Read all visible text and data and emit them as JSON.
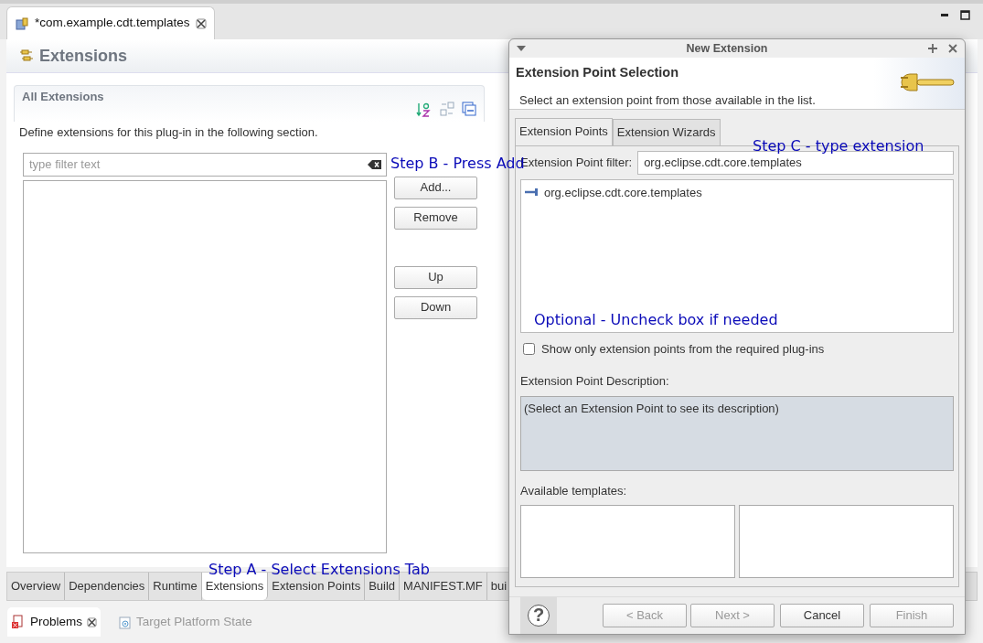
{
  "editor_tab": {
    "title": "*com.example.cdt.templates"
  },
  "page": {
    "title": "Extensions"
  },
  "section": {
    "title": "All Extensions",
    "description": "Define extensions for this plug-in in the following section.",
    "filter": {
      "placeholder": "type filter text"
    },
    "buttons": [
      {
        "label": "Add..."
      },
      {
        "label": "Remove"
      },
      {
        "label": "Up"
      },
      {
        "label": "Down"
      }
    ]
  },
  "bottom_tabs": [
    {
      "label": "Overview",
      "selected": false
    },
    {
      "label": "Dependencies",
      "selected": false
    },
    {
      "label": "Runtime",
      "selected": false
    },
    {
      "label": "Extensions",
      "selected": true
    },
    {
      "label": "Extension Points",
      "selected": false
    },
    {
      "label": "Build",
      "selected": false
    },
    {
      "label": "MANIFEST.MF",
      "selected": false
    },
    {
      "label": "bui",
      "selected": false
    }
  ],
  "views": [
    {
      "label": "Problems",
      "selected": true
    },
    {
      "label": "Target Platform State",
      "selected": false
    }
  ],
  "dialog": {
    "title": "New Extension",
    "heading": "Extension Point Selection",
    "message": "Select an extension point from those available in the list.",
    "tabs": [
      {
        "label": "Extension Points",
        "selected": true
      },
      {
        "label": "Extension Wizards",
        "selected": false
      }
    ],
    "filter_label": "Extension Point filter:",
    "filter_value": "org.eclipse.cdt.core.templates",
    "list": [
      {
        "label": "org.eclipse.cdt.core.templates"
      }
    ],
    "checkbox": {
      "label": "Show only extension points from the required plug-ins",
      "checked": false
    },
    "description_label": "Extension Point Description:",
    "description": "(Select an Extension Point to see its description)",
    "templates_label": "Available templates:",
    "help_label": "?",
    "buttons": [
      {
        "label": "< Back",
        "disabled": true
      },
      {
        "label": "Next >",
        "disabled": true
      },
      {
        "label": "Cancel",
        "disabled": false
      },
      {
        "label": "Finish",
        "disabled": true
      }
    ]
  },
  "annotations": [
    {
      "text": "Step B - Press Add"
    },
    {
      "text": "Step C - type extension"
    },
    {
      "text": "Optional - Uncheck box if needed"
    },
    {
      "text": "Step A - Select Extensions Tab"
    }
  ]
}
